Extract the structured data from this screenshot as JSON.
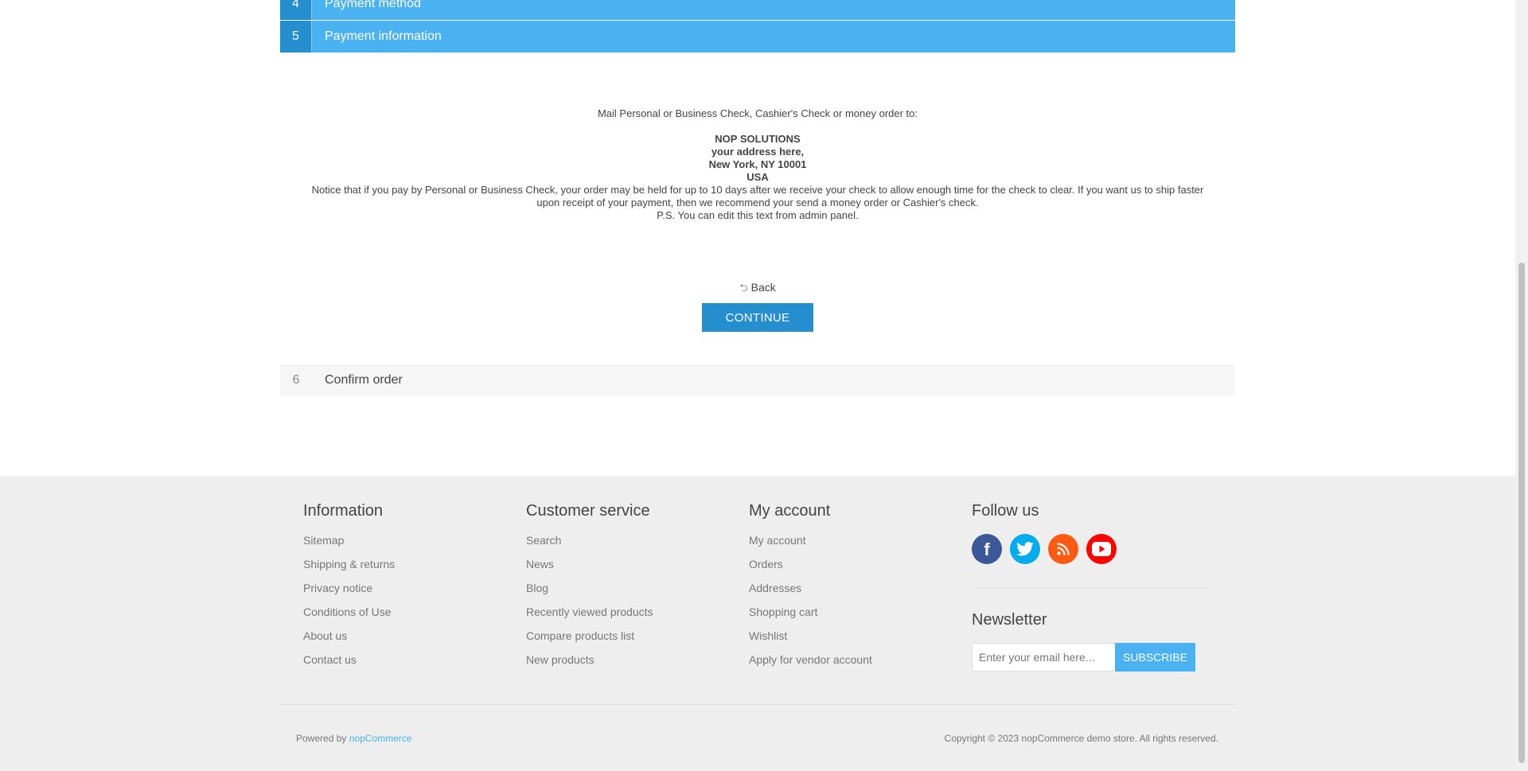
{
  "checkout": {
    "steps": [
      {
        "number": "4",
        "title": "Payment method"
      },
      {
        "number": "5",
        "title": "Payment information"
      },
      {
        "number": "6",
        "title": "Confirm order"
      }
    ],
    "payment_info": {
      "intro": "Mail Personal or Business Check, Cashier's Check or money order to:",
      "address_lines": [
        "NOP SOLUTIONS",
        "your address here,",
        "New York, NY 10001",
        "USA"
      ],
      "notice": "Notice that if you pay by Personal or Business Check, your order may be held for up to 10 days after we receive your check to allow enough time for the check to clear. If you want us to ship faster upon receipt of your payment, then we recommend your send a money order or Cashier's check.",
      "ps": "P.S. You can edit this text from admin panel."
    },
    "back_label": "Back",
    "back_icon": "back-arrow-icon",
    "continue_label": "CONTINUE"
  },
  "footer": {
    "information": {
      "title": "Information",
      "links": [
        "Sitemap",
        "Shipping & returns",
        "Privacy notice",
        "Conditions of Use",
        "About us",
        "Contact us"
      ]
    },
    "customer_service": {
      "title": "Customer service",
      "links": [
        "Search",
        "News",
        "Blog",
        "Recently viewed products",
        "Compare products list",
        "New products"
      ]
    },
    "my_account": {
      "title": "My account",
      "links": [
        "My account",
        "Orders",
        "Addresses",
        "Shopping cart",
        "Wishlist",
        "Apply for vendor account"
      ]
    },
    "follow_us": {
      "title": "Follow us",
      "networks": [
        {
          "name": "facebook-icon",
          "color": "#3b5998"
        },
        {
          "name": "twitter-icon",
          "color": "#00acee"
        },
        {
          "name": "rss-icon",
          "color": "#fe5a12"
        },
        {
          "name": "youtube-icon",
          "color": "#ff0000"
        }
      ]
    },
    "newsletter": {
      "title": "Newsletter",
      "placeholder": "Enter your email here...",
      "subscribe_label": "SUBSCRIBE"
    },
    "powered_by_prefix": "Powered by",
    "powered_by_link": "nopCommerce",
    "copyright": "Copyright © 2023 nopCommerce demo store. All rights reserved."
  },
  "colors": {
    "accent": "#4ab2f1",
    "accent_dark": "#248ece",
    "footer_bg": "#eeeeee"
  }
}
